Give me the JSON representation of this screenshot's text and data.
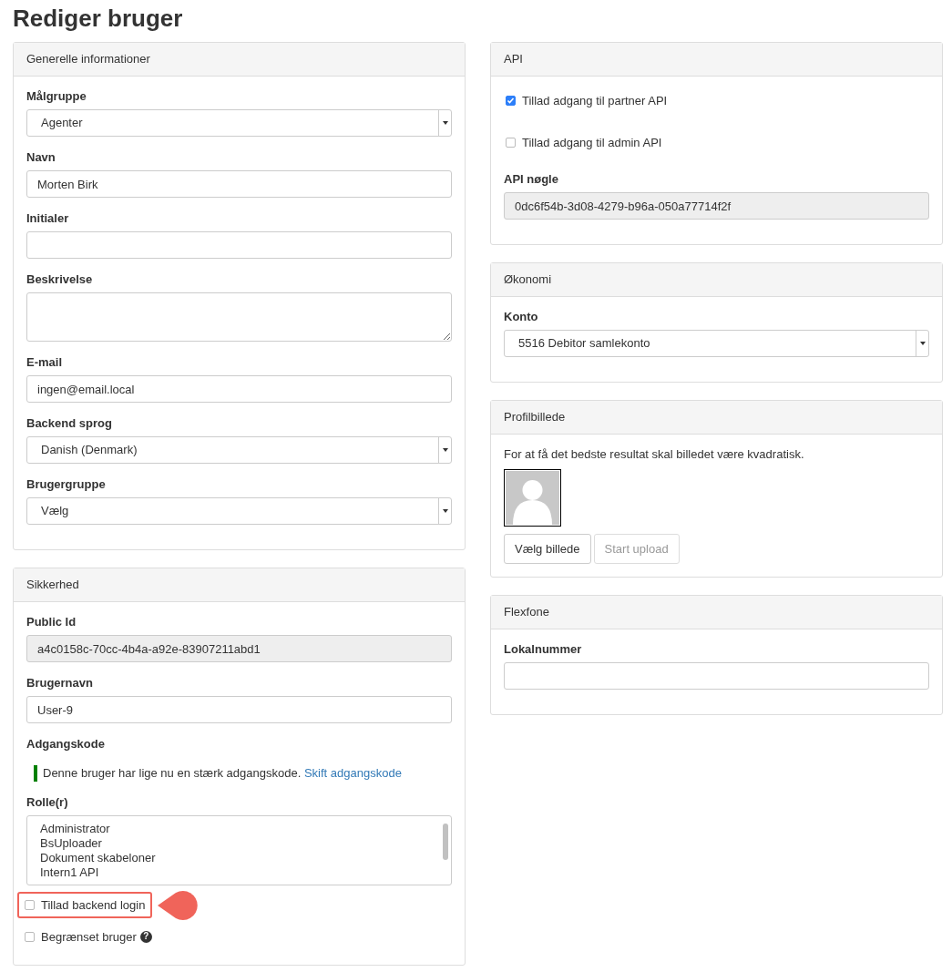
{
  "page_title": "Rediger bruger",
  "left_panels": [
    {
      "title": "Generelle informationer",
      "fields": [
        {
          "kind": "select",
          "label": "Målgruppe",
          "value": "Agenter"
        },
        {
          "kind": "text",
          "label": "Navn",
          "value": "Morten Birk"
        },
        {
          "kind": "text",
          "label": "Initialer"
        },
        {
          "kind": "textarea",
          "label": "Beskrivelse"
        },
        {
          "kind": "text",
          "label": "E-mail",
          "value": "ingen@email.local"
        },
        {
          "kind": "select",
          "label": "Backend sprog",
          "value": "Danish (Denmark)"
        },
        {
          "kind": "select",
          "label": "Brugergruppe",
          "value": "Vælg"
        }
      ]
    },
    {
      "title": "Sikkerhed",
      "fields": [
        {
          "kind": "readonly",
          "label": "Public Id",
          "value": "a4c0158c-70cc-4b4a-a92e-83907211abd1"
        },
        {
          "kind": "text",
          "label": "Brugernavn",
          "value": "User-9"
        },
        {
          "kind": "password",
          "label": "Adgangskode",
          "note": "Denne bruger har lige nu en stærk adgangskode.",
          "link": "Skift adgangskode"
        },
        {
          "kind": "listbox",
          "label": "Rolle(r)",
          "items": [
            "Administrator",
            "BsUploader",
            "Dokument skabeloner",
            "Intern1 API"
          ]
        },
        {
          "kind": "checkbox",
          "label": "Tillad backend login",
          "checked": false,
          "highlighted": true
        },
        {
          "kind": "checkbox",
          "label": "Begrænset bruger",
          "checked": false,
          "highlighted": false,
          "help": "?"
        }
      ]
    }
  ],
  "right_panels": [
    {
      "title": "API",
      "fields": [
        {
          "kind": "checkbox",
          "label": "Tillad adgang til partner API",
          "checked": true,
          "highlighted": false
        },
        {
          "kind": "checkbox",
          "label": "Tillad adgang til admin API",
          "checked": false,
          "highlighted": false
        },
        {
          "kind": "readonly",
          "label": "API nøgle",
          "value": "0dc6f54b-3d08-4279-b96a-050a77714f2f"
        }
      ]
    },
    {
      "title": "Økonomi",
      "fields": [
        {
          "kind": "select",
          "label": "Konto",
          "value": "5516 Debitor samlekonto"
        }
      ]
    },
    {
      "title": "Profilbillede",
      "fields": [
        {
          "kind": "note",
          "text": "For at få det bedste resultat skal billedet være kvadratisk."
        },
        {
          "kind": "avatar"
        },
        {
          "kind": "buttons",
          "buttons": [
            {
              "label": "Vælg billede",
              "disabled": false
            },
            {
              "label": "Start upload",
              "disabled": true
            }
          ]
        }
      ]
    },
    {
      "title": "Flexfone",
      "fields": [
        {
          "kind": "text",
          "label": "Lokalnummer"
        }
      ]
    }
  ]
}
